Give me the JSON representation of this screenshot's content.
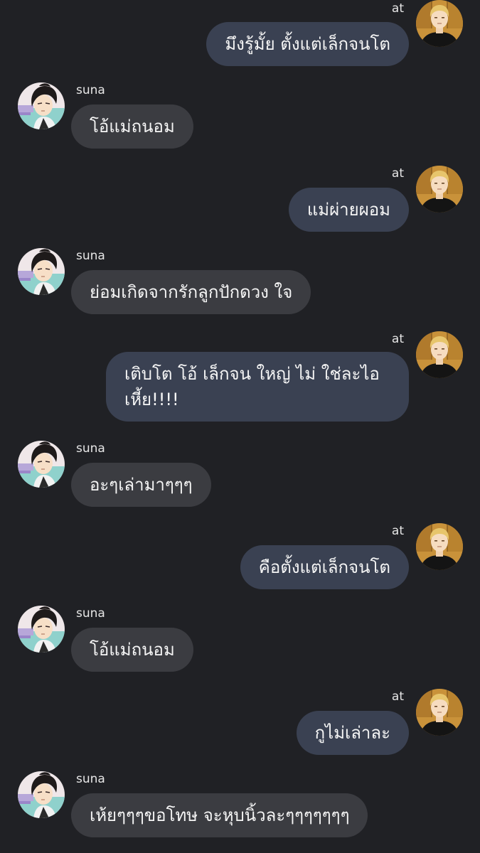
{
  "colors": {
    "background": "#202125",
    "incoming_bubble": "#3b3c41",
    "outgoing_bubble": "#3a4152",
    "text": "#f5f5f5"
  },
  "messages": [
    {
      "sender": "at",
      "side": "right",
      "text": "มึงรู้มั้ย ตั้งแต่เล็กจนโต",
      "avatar": "at-avatar"
    },
    {
      "sender": "suna",
      "side": "left",
      "text": "โอ้แม่ถนอม",
      "avatar": "suna-avatar"
    },
    {
      "sender": "at",
      "side": "right",
      "text": "แม่ผ่ายผอม",
      "avatar": "at-avatar"
    },
    {
      "sender": "suna",
      "side": "left",
      "text": "ย่อมเกิดจากรักลูกปักดวง ใจ",
      "avatar": "suna-avatar"
    },
    {
      "sender": "at",
      "side": "right",
      "text": "เติบโต โอ้ เล็กจน ใหญ่ ไม่ ใช่ละไอ\nเหี้ย!!!!",
      "avatar": "at-avatar"
    },
    {
      "sender": "suna",
      "side": "left",
      "text": "อะๆเล่ามาๆๆๆ",
      "avatar": "suna-avatar"
    },
    {
      "sender": "at",
      "side": "right",
      "text": "คือตั้งแต่เล็กจนโต",
      "avatar": "at-avatar"
    },
    {
      "sender": "suna",
      "side": "left",
      "text": "โอ้แม่ถนอม",
      "avatar": "suna-avatar"
    },
    {
      "sender": "at",
      "side": "right",
      "text": "กูไม่เล่าละ",
      "avatar": "at-avatar"
    },
    {
      "sender": "suna",
      "side": "left",
      "text": "เห้ยๆๆๆขอโทษ จะหุบนิ้วละๆๆๆๆๆๆๆ",
      "avatar": "suna-avatar"
    }
  ]
}
